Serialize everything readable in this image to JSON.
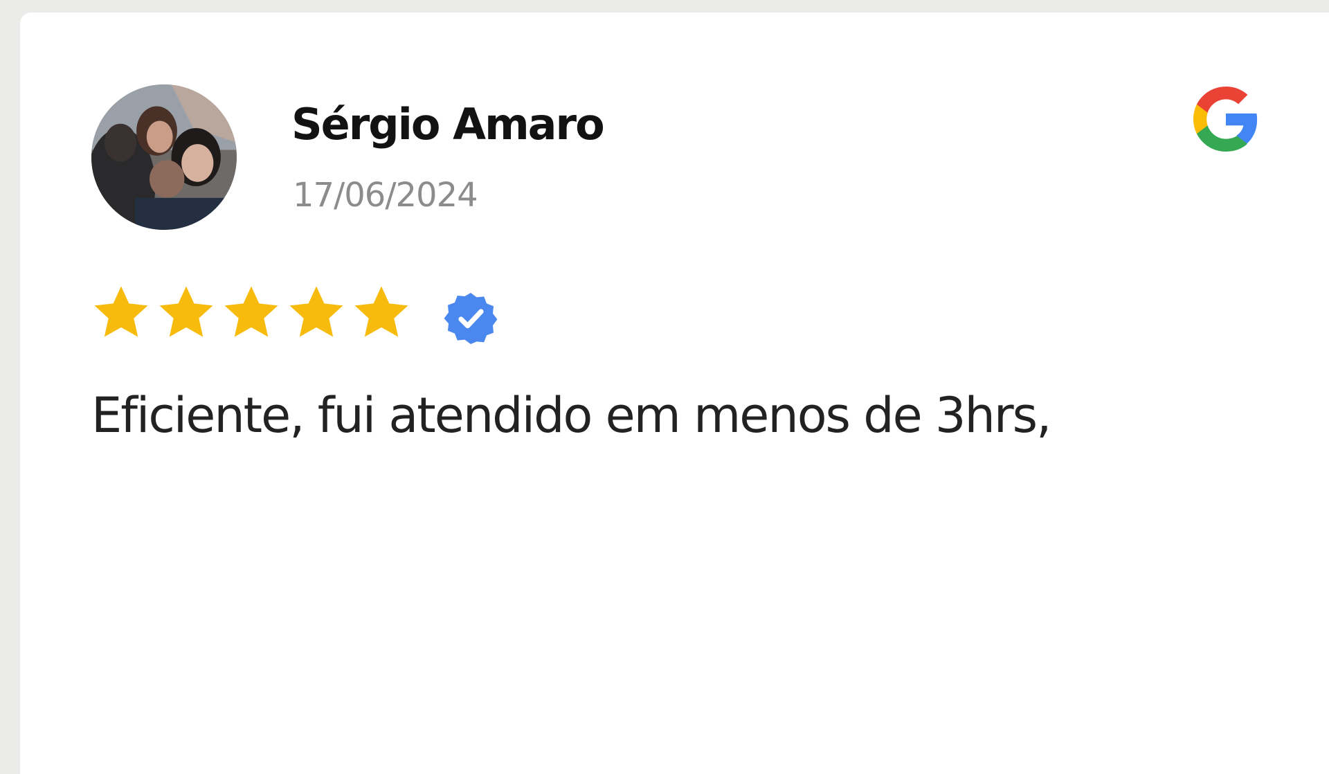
{
  "review": {
    "reviewer_name": "Sérgio Amaro",
    "date": "17/06/2024",
    "rating": 5,
    "rating_max": 5,
    "verified": true,
    "text": "Eficiente, fui atendido em menos de 3hrs,",
    "source": "google-logo-icon"
  },
  "colors": {
    "star": "#f7bb0e",
    "verified_badge": "#4a87ee",
    "google_blue": "#4285f4",
    "google_red": "#ea4335",
    "google_yellow": "#fbbc05",
    "google_green": "#34a853",
    "name": "#121212",
    "date": "#8c8c8c",
    "text": "#222222"
  },
  "icons": {
    "avatar": "avatar-photo",
    "source": "google-logo-icon",
    "rating": "star-icon",
    "verified": "verified-badge-icon"
  }
}
